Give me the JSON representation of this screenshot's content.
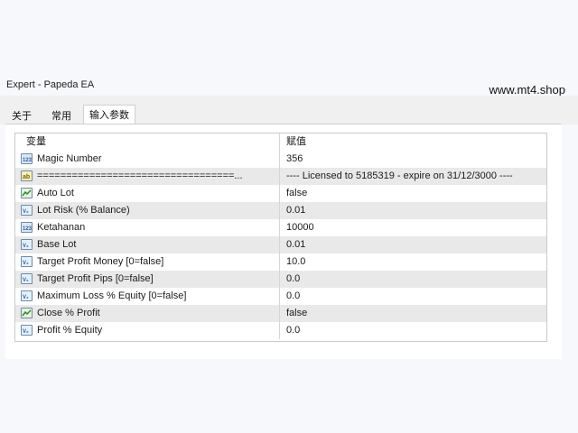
{
  "window": {
    "title": "Expert - Papeda EA",
    "watermark": "www.mt4.shop"
  },
  "tabs": [
    {
      "label": "关于"
    },
    {
      "label": "常用"
    },
    {
      "label": "输入参数"
    }
  ],
  "table": {
    "headers": {
      "variable": "变量",
      "value": "赋值"
    },
    "rows": [
      {
        "icon": "integer-icon",
        "variable": "Magic Number",
        "value": "356"
      },
      {
        "icon": "string-icon",
        "variable": "==================================...",
        "value": "---- Licensed to 5185319 - expire on 31/12/3000 ----"
      },
      {
        "icon": "boolean-icon",
        "variable": "Auto Lot",
        "value": "false"
      },
      {
        "icon": "double-icon",
        "variable": "Lot Risk (% Balance)",
        "value": "0.01"
      },
      {
        "icon": "integer-icon",
        "variable": "Ketahanan",
        "value": "10000"
      },
      {
        "icon": "double-icon",
        "variable": "Base Lot",
        "value": "0.01"
      },
      {
        "icon": "double-icon",
        "variable": "Target Profit Money [0=false]",
        "value": "10.0"
      },
      {
        "icon": "double-icon",
        "variable": "Target Profit Pips [0=false]",
        "value": "0.0"
      },
      {
        "icon": "double-icon",
        "variable": "Maximum Loss % Equity [0=false]",
        "value": "0.0"
      },
      {
        "icon": "boolean-icon",
        "variable": "Close % Profit",
        "value": "false"
      },
      {
        "icon": "double-icon",
        "variable": "Profit % Equity",
        "value": "0.0"
      }
    ]
  }
}
